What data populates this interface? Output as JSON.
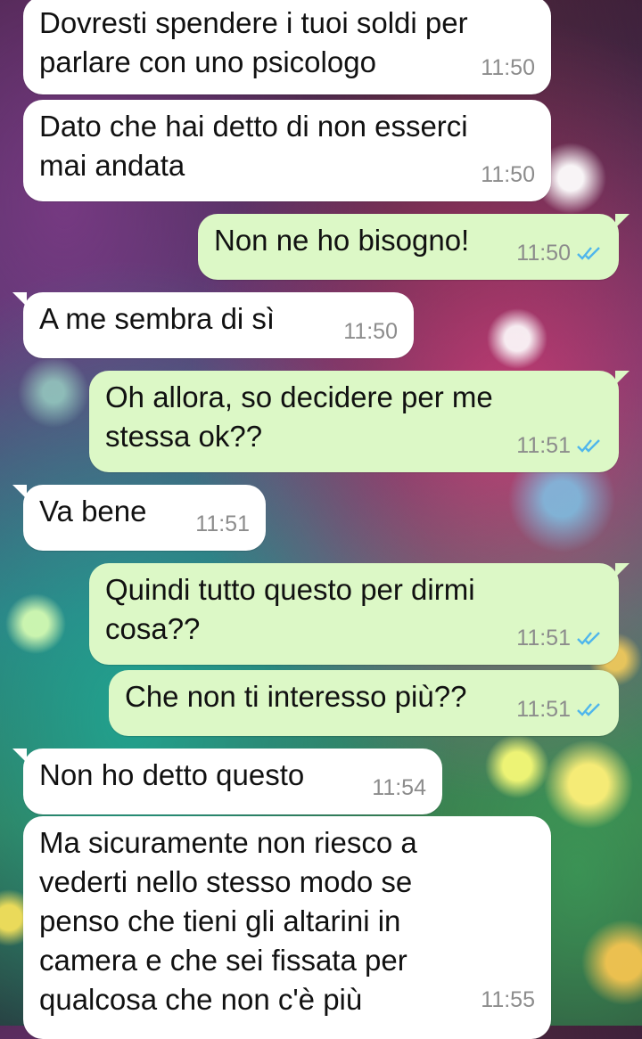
{
  "chat": {
    "messages": [
      {
        "text": "Dovresti spendere i tuoi soldi per parlare con uno psicologo",
        "time": "11:50",
        "direction": "incoming"
      },
      {
        "text": "Dato che hai detto di non esserci mai andata",
        "time": "11:50",
        "direction": "incoming"
      },
      {
        "text": "Non ne ho bisogno!",
        "time": "11:50",
        "direction": "outgoing",
        "status": "read"
      },
      {
        "text": "A me sembra di sì",
        "time": "11:50",
        "direction": "incoming"
      },
      {
        "text": "Oh allora, so decidere per me stessa ok??",
        "time": "11:51",
        "direction": "outgoing",
        "status": "read"
      },
      {
        "text": "Va bene",
        "time": "11:51",
        "direction": "incoming"
      },
      {
        "text": "Quindi tutto questo per dirmi cosa??",
        "time": "11:51",
        "direction": "outgoing",
        "status": "read"
      },
      {
        "text": "Che non ti interesso più??",
        "time": "11:51",
        "direction": "outgoing",
        "status": "read"
      },
      {
        "text": "Non ho detto questo",
        "time": "11:54",
        "direction": "incoming"
      },
      {
        "text": "Ma sicuramente non riesco a vederti nello stesso modo se penso che tieni gli altarini in camera e che sei fissata per qualcosa che non c'è più",
        "time": "11:55",
        "direction": "incoming"
      }
    ]
  },
  "colors": {
    "incoming_bubble": "#ffffff",
    "outgoing_bubble": "#dcf8c6",
    "read_check": "#4fb6ec",
    "timestamp": "#8c8c8c"
  }
}
